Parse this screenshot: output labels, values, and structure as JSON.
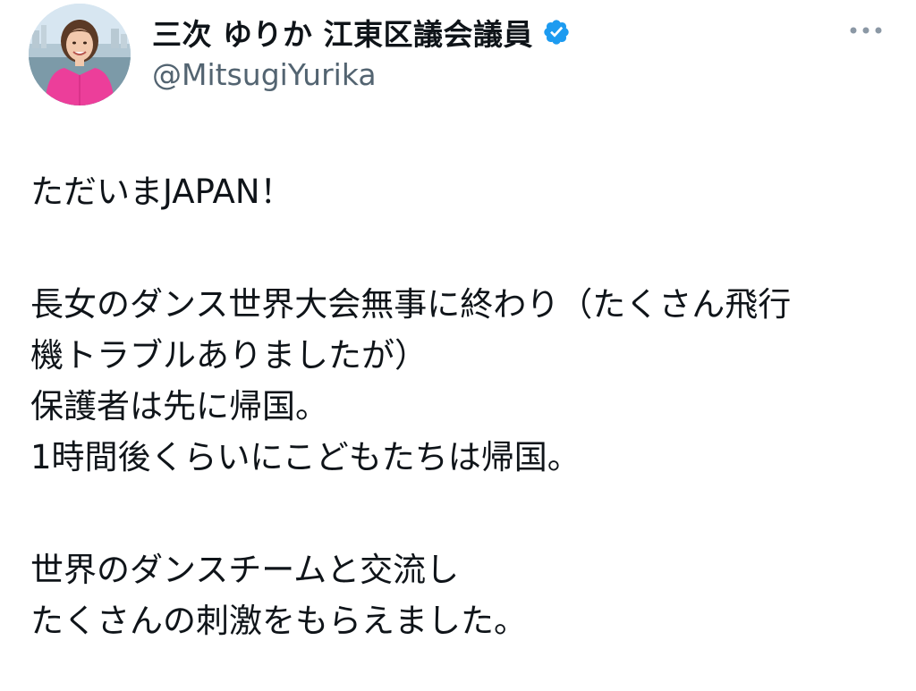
{
  "author": {
    "display_name": "三次 ゆりか 江東区議会議員",
    "handle": "@MitsugiYurika",
    "verified": true,
    "avatar_icon": "profile-photo",
    "verified_icon": "verified-badge-icon",
    "more_icon": "more-horizontal-icon"
  },
  "tweet": {
    "lines": [
      "ただいまJAPAN！",
      "",
      "長女のダンス世界大会無事に終わり（たくさん飛行",
      "機トラブルありましたが）",
      "保護者は先に帰国。",
      "1時間後くらいにこどもたちは帰国。",
      "",
      "世界のダンスチームと交流し",
      "たくさんの刺激をもらえました。"
    ]
  },
  "colors": {
    "text": "#0f1419",
    "secondary_text": "#536471",
    "verified_blue": "#1d9bf0",
    "avatar_outfit": "#ec3e9a"
  }
}
